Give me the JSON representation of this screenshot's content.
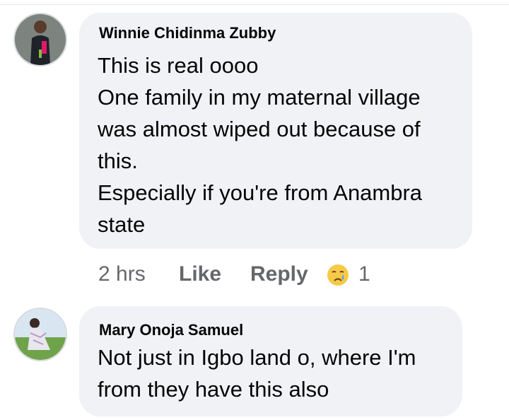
{
  "comments": [
    {
      "author": "Winnie Chidinma Zubby",
      "text": "This is real oooo\nOne family in my maternal village was almost wiped out because of this.\nEspecially if you're from Anambra state",
      "time": "2 hrs",
      "like_label": "Like",
      "reply_label": "Reply",
      "reaction_icon": "crying-face-icon",
      "reaction_count": "1"
    },
    {
      "author": "Mary Onoja Samuel",
      "text": "Not just in Igbo land o, where I'm from they have this also"
    }
  ],
  "colors": {
    "bubble": "#f0f2f5",
    "text": "#050505",
    "secondary": "#65676b"
  }
}
